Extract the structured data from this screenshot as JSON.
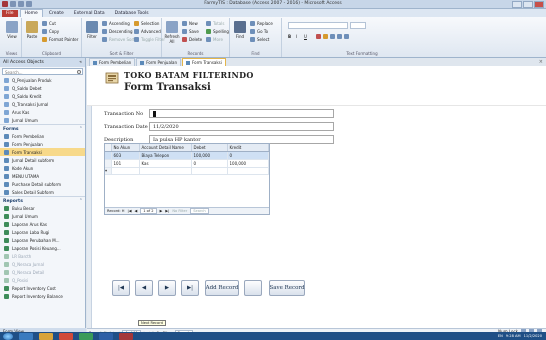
{
  "window": {
    "title": "FarmyTIS : Database (Access 2007 - 2016) - Microsoft Access"
  },
  "ribbon": {
    "tabs": [
      "File",
      "Home",
      "Create",
      "External Data",
      "Database Tools"
    ],
    "groups": [
      {
        "label": "Views",
        "big": "View"
      },
      {
        "label": "Clipboard",
        "big": "Paste",
        "items": [
          "Cut",
          "Copy",
          "Format Painter"
        ]
      },
      {
        "label": "Sort & Filter",
        "big": "Filter",
        "items": [
          "Ascending",
          "Descending",
          "Remove Sort",
          "Selection",
          "Advanced",
          "Toggle Filter"
        ]
      },
      {
        "label": "Records",
        "big": "Refresh All",
        "items": [
          "New",
          "Save",
          "Delete",
          "Totals",
          "Spelling",
          "More"
        ]
      },
      {
        "label": "Find",
        "big": "Find",
        "items": [
          "Replace",
          "Go To",
          "Select"
        ]
      },
      {
        "label": "Text Formatting",
        "items": [
          "B",
          "I",
          "U"
        ]
      }
    ]
  },
  "nav": {
    "header": "All Access Objects",
    "search_placeholder": "Search...",
    "queries": [
      "Q_Penjualan Produk",
      "Q_Saldo Debet",
      "Q_Saldo Kredit",
      "Q_Transaksi Jurnal",
      "Arus Kas",
      "Jurnal Umum"
    ],
    "forms_label": "Forms",
    "forms": [
      "Form Pembelian",
      "Form Penjualan",
      "Form Transaksi",
      "Jurnal Detail subform",
      "Kode Akun",
      "MENU UTAMA",
      "Purchase Detail subform",
      "Sales Detail Subform"
    ],
    "reports_label": "Reports",
    "reports": [
      "Buku Besar",
      "Jurnal Umum",
      "Laporan Arus Kas",
      "Laporan Laba Rugi",
      "Laporan Perubahan M...",
      "Laporan Posisi Keuang...",
      "LR Barcth",
      "Q_Neraca Jurnal",
      "Q_Neraca Detail",
      "Q_Posisi",
      "Report Inventory Cost",
      "Report Inventory Balance"
    ]
  },
  "doc_tabs": [
    "Form Pembelian",
    "Form Penjualan",
    "Form Transaksi"
  ],
  "form": {
    "company": "TOKO BATAM FILTERINDO",
    "title": "Form Transaksi",
    "transaction_no_label": "Transaction No",
    "transaction_no_value": "",
    "transaction_date_label": "Transaction Date",
    "transaction_date_value": "11/2/2020",
    "description_label": "Description",
    "description_value": "Ia pulsa HP kantor",
    "subform": {
      "columns": [
        "No Akun",
        "Account Detail Name",
        "Debet",
        "Kredit"
      ],
      "rows": [
        [
          "603",
          "Biaya Telepon",
          "100,000",
          "0"
        ],
        [
          "101",
          "Kas",
          "0",
          "100,000"
        ]
      ],
      "record_nav": {
        "label": "Record: H",
        "position": "1 of 2",
        "filter": "No Filter",
        "search": "Search"
      }
    },
    "buttons": {
      "first": "|◀",
      "prev": "◀",
      "next": "▶",
      "last": "▶|",
      "add": "Add Record",
      "blank": "",
      "save": "Save Record"
    }
  },
  "main_record_nav": {
    "label": "Record: H",
    "position": "4 of 11",
    "filter": "No Filter",
    "search": "Search",
    "tooltip": "Next Record"
  },
  "status": {
    "left": "Form View",
    "right": "Num Lock"
  },
  "taskbar": {
    "tray_text": "EN",
    "time": "9:28 AM",
    "date": "11/2/2020"
  }
}
